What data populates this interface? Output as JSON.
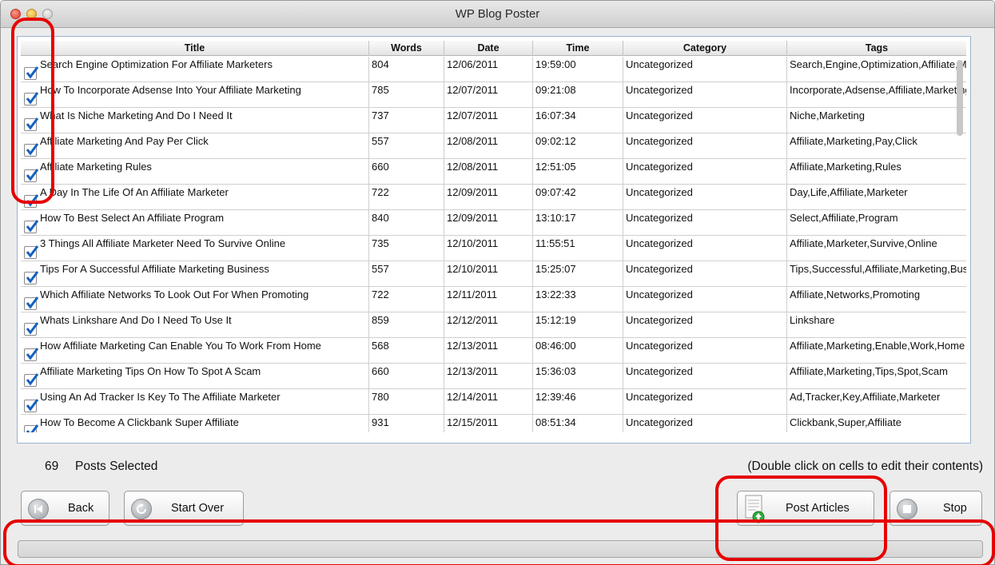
{
  "window": {
    "title": "WP Blog Poster"
  },
  "table": {
    "columns": [
      "Title",
      "Words",
      "Date",
      "Time",
      "Category",
      "Tags"
    ],
    "rows": [
      {
        "checked": true,
        "title": "Search Engine Optimization For Affiliate Marketers",
        "words": "804",
        "date": "12/06/2011",
        "time": "19:59:00",
        "category": "Uncategorized",
        "tags": "Search,Engine,Optimization,Affiliate,Marketers"
      },
      {
        "checked": true,
        "title": "How To Incorporate Adsense Into Your Affiliate Marketing",
        "words": "785",
        "date": "12/07/2011",
        "time": "09:21:08",
        "category": "Uncategorized",
        "tags": "Incorporate,Adsense,Affiliate,Marketing"
      },
      {
        "checked": true,
        "title": "What Is Niche Marketing And Do I Need It",
        "words": "737",
        "date": "12/07/2011",
        "time": "16:07:34",
        "category": "Uncategorized",
        "tags": "Niche,Marketing"
      },
      {
        "checked": true,
        "title": "Affiliate Marketing And Pay Per Click",
        "words": "557",
        "date": "12/08/2011",
        "time": "09:02:12",
        "category": "Uncategorized",
        "tags": "Affiliate,Marketing,Pay,Click"
      },
      {
        "checked": true,
        "title": "Affiliate Marketing Rules",
        "words": "660",
        "date": "12/08/2011",
        "time": "12:51:05",
        "category": "Uncategorized",
        "tags": "Affiliate,Marketing,Rules"
      },
      {
        "checked": true,
        "title": "A Day In The Life Of An Affiliate Marketer",
        "words": "722",
        "date": "12/09/2011",
        "time": "09:07:42",
        "category": "Uncategorized",
        "tags": "Day,Life,Affiliate,Marketer"
      },
      {
        "checked": true,
        "title": "How To Best Select An Affiliate Program",
        "words": "840",
        "date": "12/09/2011",
        "time": "13:10:17",
        "category": "Uncategorized",
        "tags": "Select,Affiliate,Program"
      },
      {
        "checked": true,
        "title": "3 Things All Affiliate Marketer Need To Survive Online",
        "words": "735",
        "date": "12/10/2011",
        "time": "11:55:51",
        "category": "Uncategorized",
        "tags": "Affiliate,Marketer,Survive,Online"
      },
      {
        "checked": true,
        "title": "Tips For A Successful Affiliate Marketing Business",
        "words": "557",
        "date": "12/10/2011",
        "time": "15:25:07",
        "category": "Uncategorized",
        "tags": "Tips,Successful,Affiliate,Marketing,Business"
      },
      {
        "checked": true,
        "title": "Which Affiliate Networks To Look Out For When Promoting",
        "words": "722",
        "date": "12/11/2011",
        "time": "13:22:33",
        "category": "Uncategorized",
        "tags": "Affiliate,Networks,Promoting"
      },
      {
        "checked": true,
        "title": "Whats Linkshare And Do I Need To Use It",
        "words": "859",
        "date": "12/12/2011",
        "time": "15:12:19",
        "category": "Uncategorized",
        "tags": "Linkshare"
      },
      {
        "checked": true,
        "title": "How Affiliate Marketing Can Enable You To Work From Home",
        "words": "568",
        "date": "12/13/2011",
        "time": "08:46:00",
        "category": "Uncategorized",
        "tags": "Affiliate,Marketing,Enable,Work,Home"
      },
      {
        "checked": true,
        "title": "Affiliate Marketing Tips On How To Spot A Scam",
        "words": "660",
        "date": "12/13/2011",
        "time": "15:36:03",
        "category": "Uncategorized",
        "tags": "Affiliate,Marketing,Tips,Spot,Scam"
      },
      {
        "checked": true,
        "title": "Using An Ad Tracker Is Key To The Affiliate Marketer",
        "words": "780",
        "date": "12/14/2011",
        "time": "12:39:46",
        "category": "Uncategorized",
        "tags": "Ad,Tracker,Key,Affiliate,Marketer"
      },
      {
        "checked": true,
        "title": "How To Become A Clickbank Super Affiliate",
        "words": "931",
        "date": "12/15/2011",
        "time": "08:51:34",
        "category": "Uncategorized",
        "tags": "Clickbank,Super,Affiliate"
      }
    ]
  },
  "status": {
    "count": "69",
    "count_label": "Posts Selected",
    "hint": "(Double click on cells to edit their contents)"
  },
  "buttons": {
    "back": "Back",
    "start_over": "Start Over",
    "post_articles": "Post Articles",
    "stop": "Stop"
  },
  "progress": {
    "fraction": 0
  },
  "colors": {
    "check": "#1560bd",
    "annotation": "#e60000",
    "table_border": "#9bb3cf"
  }
}
